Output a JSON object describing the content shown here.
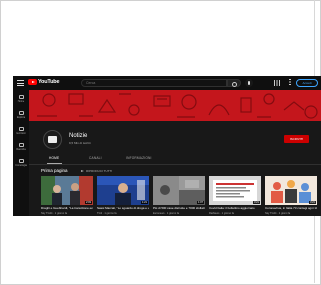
{
  "topbar": {
    "logo_text": "YouTube",
    "search_placeholder": "Cerca",
    "signin_label": "Accedi"
  },
  "sidebar": {
    "items": [
      {
        "label": "Home",
        "icon": "home-icon"
      },
      {
        "label": "Esplora",
        "icon": "explore-icon"
      },
      {
        "label": "Iscrizioni",
        "icon": "subscriptions-icon"
      },
      {
        "label": "Raccolta",
        "icon": "library-icon"
      },
      {
        "label": "Cronologia",
        "icon": "history-icon"
      }
    ]
  },
  "channel": {
    "name": "Notizie",
    "subscribers": "9,5 Mln di iscritti",
    "subscribe_label": "ISCRIVITI"
  },
  "tabs": [
    {
      "label": "HOME",
      "active": true
    },
    {
      "label": "CANALI",
      "active": false
    },
    {
      "label": "INFORMAZIONI",
      "active": false
    }
  ],
  "section": {
    "title": "Prima pagina",
    "play_all": "RIPRODUCI TUTTI"
  },
  "videos": [
    {
      "title": "Draghi e Guebhardt, \"La transizione ecologica non...",
      "meta": "Sky TG24 · 1 giorno fa",
      "duration": "2:03"
    },
    {
      "title": "Sassi Marcati, \"Lo sguardo di droga e una priv...",
      "meta": "TG3 · 1 giorno fa",
      "duration": "1:21"
    },
    {
      "title": "Più di 500 case distrutte e 7000 sfollati: alle Canarie...",
      "meta": "Euronews · 1 giorno fa",
      "duration": "1:07"
    },
    {
      "title": "Covid Italia: il bollettino aggiornato",
      "meta": "RaiNews · 1 giorno fa",
      "duration": "3:21"
    },
    {
      "title": "Coronavirus, in Italia 73 contagi ogni 100mila...",
      "meta": "Sky TG24 · 2 giorni fa",
      "duration": "3:21"
    }
  ],
  "colors": {
    "banner": "#c4161c",
    "subscribe": "#cc0000",
    "background": "#181818"
  }
}
